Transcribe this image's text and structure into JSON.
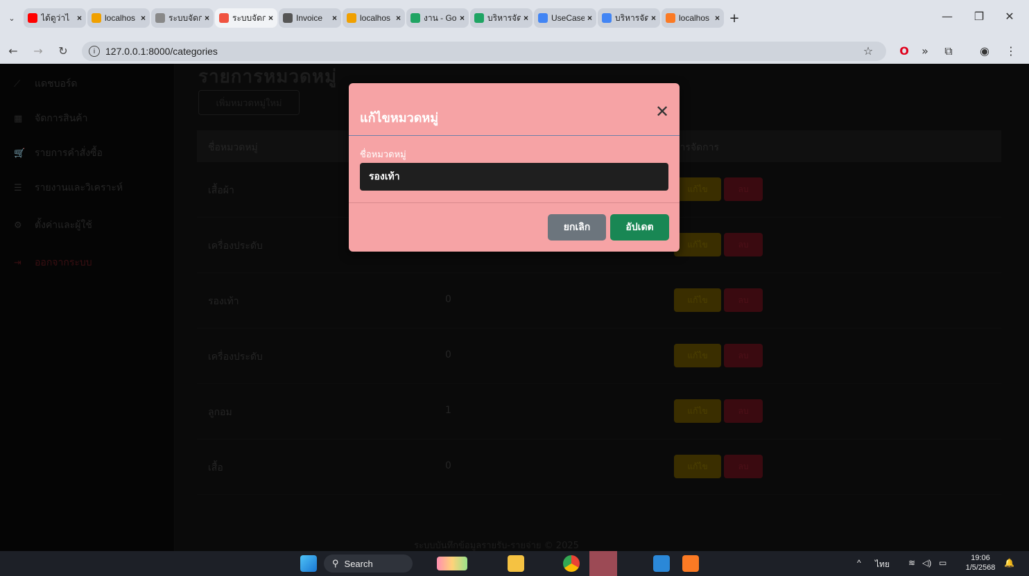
{
  "browser": {
    "tabs": [
      {
        "label": "ได้ดูว่าไ",
        "favicon_color": "#ff0000",
        "active": false
      },
      {
        "label": "localhos",
        "favicon_color": "#f0a000",
        "active": false
      },
      {
        "label": "ระบบจัดก",
        "favicon_color": "#888888",
        "active": false
      },
      {
        "label": "ระบบจัดก",
        "favicon_color": "#f05340",
        "active": true
      },
      {
        "label": "Invoice",
        "favicon_color": "#555555",
        "active": false
      },
      {
        "label": "localhos",
        "favicon_color": "#f0a000",
        "active": false
      },
      {
        "label": "งาน - Go",
        "favicon_color": "#1fa463",
        "active": false
      },
      {
        "label": "บริหารจัด",
        "favicon_color": "#1fa463",
        "active": false
      },
      {
        "label": "UseCase",
        "favicon_color": "#4285f4",
        "active": false
      },
      {
        "label": "บริหารจัด",
        "favicon_color": "#4285f4",
        "active": false
      },
      {
        "label": "localhos",
        "favicon_color": "#fb7a24",
        "active": false
      }
    ],
    "tab_close": "×",
    "new_tab": "+",
    "url": "127.0.0.1:8000/categories"
  },
  "sidebar": {
    "items": [
      {
        "label": "แดชบอร์ด",
        "icon": "chart-line-icon",
        "glyph": "⟋"
      },
      {
        "label": "จัดการสินค้า",
        "icon": "box-icon",
        "glyph": "▦"
      },
      {
        "label": "รายการคำสั่งซื้อ",
        "icon": "cart-icon",
        "glyph": "🛒"
      },
      {
        "label": "รายงานและวิเคราะห์",
        "icon": "list-icon",
        "glyph": "☰"
      },
      {
        "label": "ตั้งค่าและผู้ใช้",
        "icon": "gears-icon",
        "glyph": "⚙"
      },
      {
        "label": "ออกจากระบบ",
        "icon": "logout-icon",
        "glyph": "⇥"
      }
    ]
  },
  "main": {
    "title": "รายการหมวดหมู่",
    "add_button": "เพิ่มหมวดหมู่ใหม่",
    "columns": [
      "ชื่อหมวดหมู่",
      "",
      "การจัดการ"
    ],
    "rows": [
      {
        "name": "เสื้อผ้า",
        "count": ""
      },
      {
        "name": "เครื่องประดับ",
        "count": ""
      },
      {
        "name": "รองเท้า",
        "count": "0"
      },
      {
        "name": "เครื่องประดับ",
        "count": "0"
      },
      {
        "name": "ลูกอม",
        "count": "1"
      },
      {
        "name": "เสื้อ",
        "count": "0"
      }
    ],
    "edit_label": "แก้ไข",
    "delete_label": "ลบ",
    "footer": "ระบบบันทึกข้อมูลรายรับ-รายจ่าย © 2025"
  },
  "modal": {
    "title": "แก้ไขหมวดหมู่",
    "field_label": "ชื่อหมวดหมู่",
    "field_value": "รองเท้า",
    "cancel_label": "ยกเลิก",
    "update_label": "อัปเดต",
    "bg_color": "#f6a3a5",
    "update_color": "#198754",
    "cancel_color": "#6c757d"
  },
  "taskbar": {
    "search_label": "Search",
    "language": "ไทย",
    "time": "19:06",
    "date": "1/5/2568"
  }
}
